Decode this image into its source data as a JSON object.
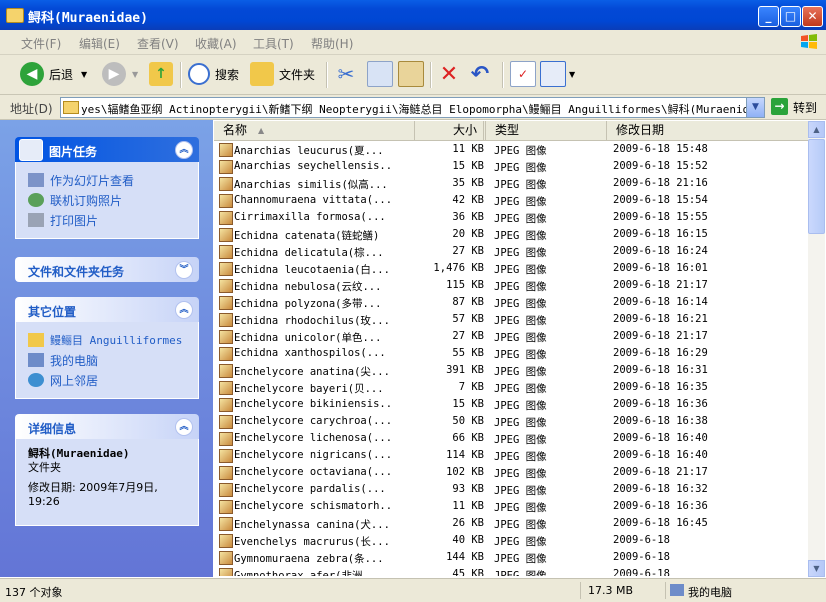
{
  "window": {
    "title": "鲟科(Muraenidae)"
  },
  "menu": [
    "文件(F)",
    "编辑(E)",
    "查看(V)",
    "收藏(A)",
    "工具(T)",
    "帮助(H)"
  ],
  "toolbar": {
    "back": "后退",
    "search": "搜索",
    "folders": "文件夹"
  },
  "address": {
    "label": "地址(D)",
    "path": "yes\\辐鳍鱼亚纲 Actinopterygii\\新鳍下纲 Neopterygii\\海鲢总目 Elopomorpha\\鳗鲡目 Anguilliformes\\鲟科(Muraenidae)",
    "go": "转到"
  },
  "tasks": {
    "picture": {
      "title": "图片任务",
      "items": [
        "作为幻灯片查看",
        "联机订购照片",
        "打印图片"
      ]
    },
    "file_folder": {
      "title": "文件和文件夹任务"
    },
    "other": {
      "title": "其它位置",
      "items": [
        "鳗鲡目 Anguilliformes",
        "我的电脑",
        "网上邻居"
      ]
    },
    "details": {
      "title": "详细信息",
      "name": "鲟科(Muraenidae)",
      "kind": "文件夹",
      "modified": "修改日期: 2009年7月9日, 19:26"
    }
  },
  "columns": {
    "name": "名称",
    "size": "大小",
    "type": "类型",
    "date": "修改日期"
  },
  "files": [
    {
      "name": "Anarchias leucurus(夏...",
      "size": "11 KB",
      "type": "JPEG 图像",
      "date": "2009-6-18 15:48"
    },
    {
      "name": "Anarchias seychellensis...",
      "size": "15 KB",
      "type": "JPEG 图像",
      "date": "2009-6-18 15:52"
    },
    {
      "name": "Anarchias similis(似高...",
      "size": "35 KB",
      "type": "JPEG 图像",
      "date": "2009-6-18 21:16"
    },
    {
      "name": "Channomuraena vittata(...",
      "size": "42 KB",
      "type": "JPEG 图像",
      "date": "2009-6-18 15:54"
    },
    {
      "name": "Cirrimaxilla formosa(...",
      "size": "36 KB",
      "type": "JPEG 图像",
      "date": "2009-6-18 15:55"
    },
    {
      "name": "Echidna catenata(链蛇鳝)",
      "size": "20 KB",
      "type": "JPEG 图像",
      "date": "2009-6-18 16:15"
    },
    {
      "name": "Echidna delicatula(棕...",
      "size": "27 KB",
      "type": "JPEG 图像",
      "date": "2009-6-18 16:24"
    },
    {
      "name": "Echidna leucotaenia(白...",
      "size": "1,476 KB",
      "type": "JPEG 图像",
      "date": "2009-6-18 16:01"
    },
    {
      "name": "Echidna nebulosa(云纹...",
      "size": "115 KB",
      "type": "JPEG 图像",
      "date": "2009-6-18 21:17"
    },
    {
      "name": "Echidna polyzona(多带...",
      "size": "87 KB",
      "type": "JPEG 图像",
      "date": "2009-6-18 16:14"
    },
    {
      "name": "Echidna rhodochilus(玫...",
      "size": "57 KB",
      "type": "JPEG 图像",
      "date": "2009-6-18 16:21"
    },
    {
      "name": "Echidna unicolor(单色...",
      "size": "27 KB",
      "type": "JPEG 图像",
      "date": "2009-6-18 21:17"
    },
    {
      "name": "Echidna xanthospilos(...",
      "size": "55 KB",
      "type": "JPEG 图像",
      "date": "2009-6-18 16:29"
    },
    {
      "name": "Enchelycore anatina(尖...",
      "size": "391 KB",
      "type": "JPEG 图像",
      "date": "2009-6-18 16:31"
    },
    {
      "name": "Enchelycore bayeri(贝...",
      "size": "7 KB",
      "type": "JPEG 图像",
      "date": "2009-6-18 16:35"
    },
    {
      "name": "Enchelycore bikiniensis...",
      "size": "15 KB",
      "type": "JPEG 图像",
      "date": "2009-6-18 16:36"
    },
    {
      "name": "Enchelycore carychroa(...",
      "size": "50 KB",
      "type": "JPEG 图像",
      "date": "2009-6-18 16:38"
    },
    {
      "name": "Enchelycore lichenosa(...",
      "size": "66 KB",
      "type": "JPEG 图像",
      "date": "2009-6-18 16:40"
    },
    {
      "name": "Enchelycore nigricans(...",
      "size": "114 KB",
      "type": "JPEG 图像",
      "date": "2009-6-18 16:40"
    },
    {
      "name": "Enchelycore octaviana(...",
      "size": "102 KB",
      "type": "JPEG 图像",
      "date": "2009-6-18 21:17"
    },
    {
      "name": "Enchelycore pardalis(...",
      "size": "93 KB",
      "type": "JPEG 图像",
      "date": "2009-6-18 16:32"
    },
    {
      "name": "Enchelycore schismatorh...",
      "size": "11 KB",
      "type": "JPEG 图像",
      "date": "2009-6-18 16:36"
    },
    {
      "name": "Enchelynassa canina(犬...",
      "size": "26 KB",
      "type": "JPEG 图像",
      "date": "2009-6-18 16:45"
    },
    {
      "name": "Evenchelys macrurus(长...",
      "size": "40 KB",
      "type": "JPEG 图像",
      "date": "2009-6-18"
    },
    {
      "name": "Gymnomuraena zebra(条...",
      "size": "144 KB",
      "type": "JPEG 图像",
      "date": "2009-6-18"
    },
    {
      "name": "Gymnothorax afer(非洲...",
      "size": "45 KB",
      "type": "JPEG 图像",
      "date": "2009-6-18"
    }
  ],
  "status": {
    "count": "137 个对象",
    "size": "17.3 MB",
    "location": "我的电脑"
  },
  "colors": {
    "titlebar": "#0349d6",
    "taskpane": "#6d8ee0",
    "link": "#215dc6"
  }
}
